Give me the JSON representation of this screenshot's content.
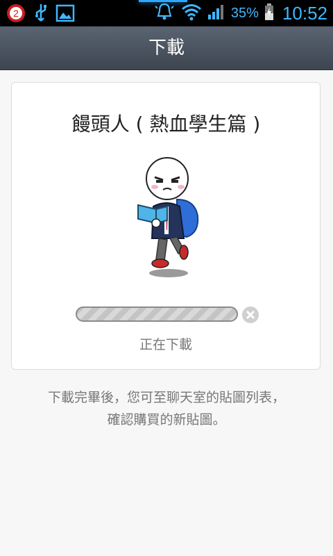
{
  "statusbar": {
    "notification_count": "2",
    "battery_percent": "35%",
    "time": "10:52",
    "icons": [
      "notification-badge-icon",
      "usb-icon",
      "image-icon",
      "alarm-icon",
      "wifi-icon",
      "signal-icon",
      "battery-charging-icon"
    ]
  },
  "header": {
    "title": "下載"
  },
  "card": {
    "sticker_title": "饅頭人 ( 熱血學生篇 )",
    "progress_percent": 0,
    "status": "正在下載"
  },
  "note": {
    "line1": "下載完畢後，您可至聊天室的貼圖列表，",
    "line2": "確認購買的新貼圖。"
  },
  "colors": {
    "accent": "#3fb8ff",
    "header_top": "#5a6472",
    "header_bottom": "#3d4550"
  }
}
